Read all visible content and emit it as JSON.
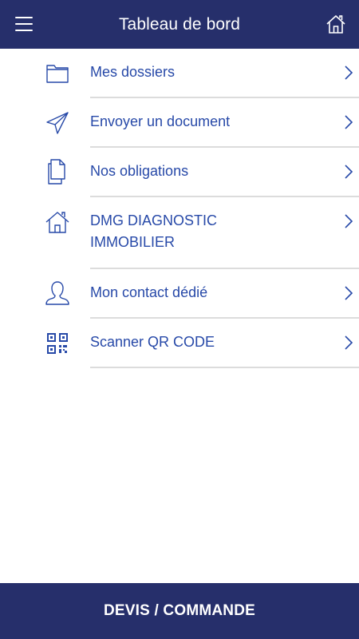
{
  "header": {
    "title": "Tableau de bord",
    "menu_icon": "hamburger-menu-icon",
    "home_icon": "home-icon"
  },
  "menu": {
    "items": [
      {
        "label": "Mes dossiers",
        "icon": "folder-icon"
      },
      {
        "label": "Envoyer un document",
        "icon": "send-icon"
      },
      {
        "label": "Nos obligations",
        "icon": "documents-icon"
      },
      {
        "label": "DMG DIAGNOSTIC IMMOBILIER",
        "icon": "house-icon"
      },
      {
        "label": "Mon contact dédié",
        "icon": "user-icon"
      },
      {
        "label": "Scanner QR CODE",
        "icon": "qr-code-icon"
      }
    ]
  },
  "footer": {
    "cta_label": "DEVIS / COMMANDE"
  },
  "colors": {
    "primary_navy": "#262f6b",
    "link_blue": "#2749a8",
    "divider": "#dcdcdc"
  }
}
